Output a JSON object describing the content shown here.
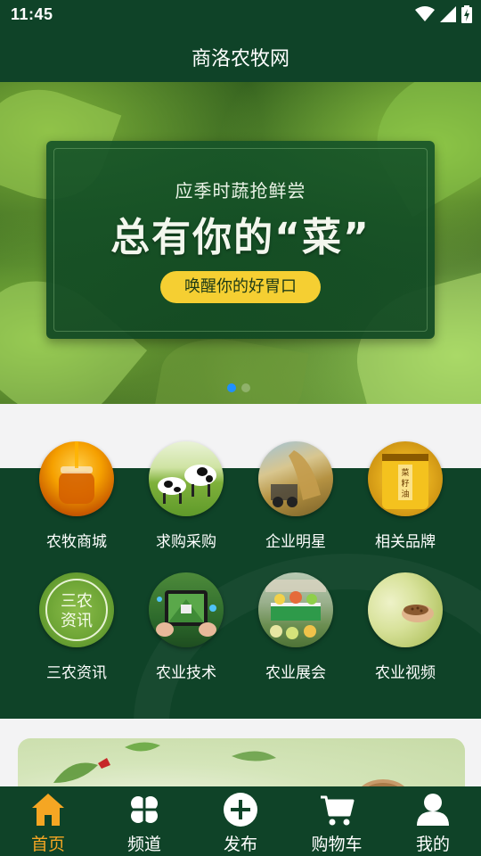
{
  "status_bar": {
    "time": "11:45",
    "icons": [
      "wifi-icon",
      "signal-icon",
      "battery-charging-icon"
    ]
  },
  "header": {
    "title": "商洛农牧网"
  },
  "banner": {
    "subtitle": "应季时蔬抢鲜尝",
    "headline": "总有你的“菜”",
    "button_label": "唤醒你的好胃口",
    "slides": 2,
    "active_slide": 1
  },
  "menu": {
    "items": [
      {
        "label": "农牧商城",
        "icon": "honey-jar-icon"
      },
      {
        "label": "求购采购",
        "icon": "cows-icon"
      },
      {
        "label": "企业明星",
        "icon": "harvest-icon"
      },
      {
        "label": "相关品牌",
        "icon": "rapeseed-oil-icon"
      },
      {
        "label": "三农资讯",
        "icon": "sannong-news-icon",
        "icon_text": "三农资讯"
      },
      {
        "label": "农业技术",
        "icon": "tablet-tech-icon"
      },
      {
        "label": "农业展会",
        "icon": "expo-icon"
      },
      {
        "label": "农业视频",
        "icon": "grain-hand-icon"
      }
    ]
  },
  "tabs": [
    {
      "label": "首页",
      "icon": "home-icon",
      "active": true
    },
    {
      "label": "频道",
      "icon": "channels-icon",
      "active": false
    },
    {
      "label": "发布",
      "icon": "publish-plus-icon",
      "active": false
    },
    {
      "label": "购物车",
      "icon": "cart-icon",
      "active": false
    },
    {
      "label": "我的",
      "icon": "profile-icon",
      "active": false
    }
  ],
  "colors": {
    "primary": "#0f4328",
    "accent": "#f5a623",
    "banner_button": "#f5cf32",
    "dot_active": "#1e90ff"
  }
}
